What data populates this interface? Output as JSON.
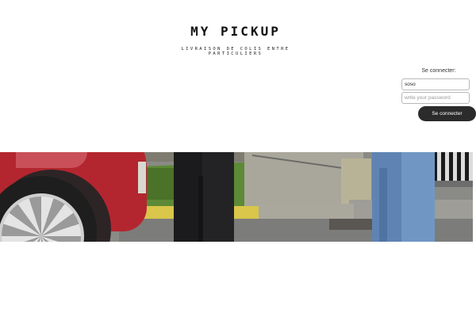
{
  "header": {
    "title": "MY PICKUP",
    "subtitle": "LIVRAISON DE COLIS ENTRE PARTICULIERS"
  },
  "login": {
    "label": "Se connecter:",
    "username_value": "soso",
    "password_placeholder": "write your password",
    "submit_label": "Se connecter"
  },
  "colors": {
    "background": "#ffffff",
    "button": "#2b2b2b",
    "button_text": "#ffffff"
  }
}
